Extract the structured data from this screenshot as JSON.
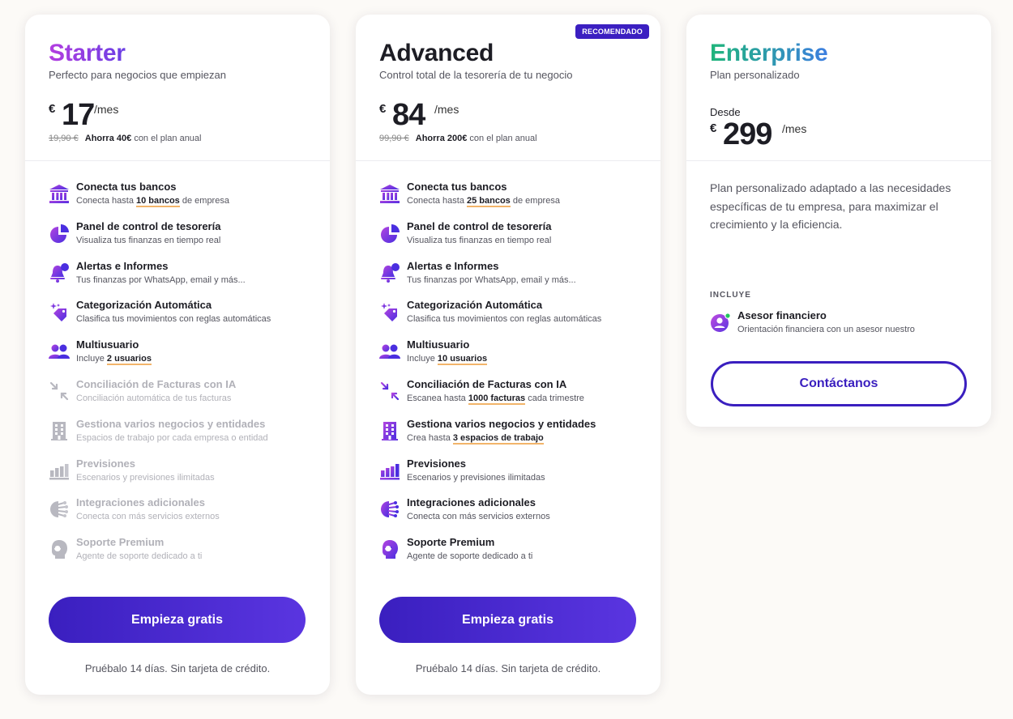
{
  "colors": {
    "accent": "#3b1fc1",
    "highlight": "#f2b46a",
    "background": "#fcfaf7"
  },
  "plans": [
    {
      "name": "Starter",
      "tagline": "Perfecto para negocios que empiezan",
      "currency": "€",
      "price": "17",
      "period": "/mes",
      "old_price": "19,90 €",
      "savings": "Ahorra 40€",
      "savings_note": "con el plan anual",
      "features": [
        {
          "icon": "bank-icon",
          "title": "Conecta tus bancos",
          "pre": "Conecta hasta ",
          "hl": "10 bancos",
          "post": " de empresa",
          "enabled": true
        },
        {
          "icon": "pie-chart-icon",
          "title": "Panel de control de tesorería",
          "pre": "Visualiza tus finanzas en tiempo real",
          "hl": "",
          "post": "",
          "enabled": true
        },
        {
          "icon": "bell-icon",
          "title": "Alertas e Informes",
          "pre": "Tus finanzas por WhatsApp, email y más...",
          "hl": "",
          "post": "",
          "enabled": true
        },
        {
          "icon": "sparkle-tag-icon",
          "title": "Categorización Automática",
          "pre": "Clasifica tus movimientos con reglas automáticas",
          "hl": "",
          "post": "",
          "enabled": true
        },
        {
          "icon": "users-icon",
          "title": "Multiusuario",
          "pre": "Incluye ",
          "hl": "2 usuarios",
          "post": "",
          "enabled": true
        },
        {
          "icon": "merge-arrows-icon",
          "title": "Conciliación de Facturas con IA",
          "pre": "Conciliación automática de tus facturas",
          "hl": "",
          "post": "",
          "enabled": false
        },
        {
          "icon": "building-icon",
          "title": "Gestiona varios negocios y entidades",
          "pre": "Espacios de trabajo por cada empresa o entidad",
          "hl": "",
          "post": "",
          "enabled": false
        },
        {
          "icon": "bar-chart-icon",
          "title": "Previsiones",
          "pre": "Escenarios y previsiones ilimitadas",
          "hl": "",
          "post": "",
          "enabled": false
        },
        {
          "icon": "integrations-icon",
          "title": "Integraciones adicionales",
          "pre": "Conecta con más servicios externos",
          "hl": "",
          "post": "",
          "enabled": false
        },
        {
          "icon": "support-agent-icon",
          "title": "Soporte Premium",
          "pre": "Agente de soporte dedicado a ti",
          "hl": "",
          "post": "",
          "enabled": false
        }
      ],
      "cta": "Empieza gratis",
      "trial": "Pruébalo 14 días. Sin tarjeta de crédito."
    },
    {
      "name": "Advanced",
      "badge": "RECOMENDADO",
      "tagline": "Control total de la tesorería de tu negocio",
      "currency": "€",
      "price": "84",
      "period": "/mes",
      "old_price": "99,90 €",
      "savings": "Ahorra 200€",
      "savings_note": "con el plan anual",
      "features": [
        {
          "icon": "bank-icon",
          "title": "Conecta tus bancos",
          "pre": "Conecta hasta ",
          "hl": "25 bancos",
          "post": " de empresa",
          "enabled": true
        },
        {
          "icon": "pie-chart-icon",
          "title": "Panel de control de tesorería",
          "pre": "Visualiza tus finanzas en tiempo real",
          "hl": "",
          "post": "",
          "enabled": true
        },
        {
          "icon": "bell-icon",
          "title": "Alertas e Informes",
          "pre": "Tus finanzas por WhatsApp, email y más...",
          "hl": "",
          "post": "",
          "enabled": true
        },
        {
          "icon": "sparkle-tag-icon",
          "title": "Categorización Automática",
          "pre": "Clasifica tus movimientos con reglas automáticas",
          "hl": "",
          "post": "",
          "enabled": true
        },
        {
          "icon": "users-icon",
          "title": "Multiusuario",
          "pre": "Incluye ",
          "hl": "10 usuarios",
          "post": "",
          "enabled": true
        },
        {
          "icon": "merge-arrows-icon",
          "title": "Conciliación de Facturas con IA",
          "pre": "Escanea hasta ",
          "hl": "1000 facturas",
          "post": " cada trimestre",
          "enabled": true
        },
        {
          "icon": "building-icon",
          "title": "Gestiona varios negocios y entidades",
          "pre": "Crea hasta ",
          "hl": "3 espacios de trabajo",
          "post": "",
          "enabled": true
        },
        {
          "icon": "bar-chart-icon",
          "title": "Previsiones",
          "pre": "Escenarios y previsiones ilimitadas",
          "hl": "",
          "post": "",
          "enabled": true
        },
        {
          "icon": "integrations-icon",
          "title": "Integraciones adicionales",
          "pre": "Conecta con más servicios externos",
          "hl": "",
          "post": "",
          "enabled": true
        },
        {
          "icon": "support-agent-icon",
          "title": "Soporte Premium",
          "pre": "Agente de soporte dedicado a ti",
          "hl": "",
          "post": "",
          "enabled": true
        }
      ],
      "cta": "Empieza gratis",
      "trial": "Pruébalo 14 días. Sin tarjeta de crédito."
    }
  ],
  "enterprise": {
    "name": "Enterprise",
    "tagline": "Plan personalizado",
    "from": "Desde",
    "currency": "€",
    "price": "299",
    "period": "/mes",
    "description": "Plan personalizado adaptado a las necesidades específicas de tu empresa, para maximizar el crecimiento y la eficiencia.",
    "includes_label": "INCLUYE",
    "advisor_title": "Asesor financiero",
    "advisor_sub": "Orientación financiera con un asesor nuestro",
    "advisor_icon": "advisor-avatar-icon",
    "cta": "Contáctanos"
  }
}
